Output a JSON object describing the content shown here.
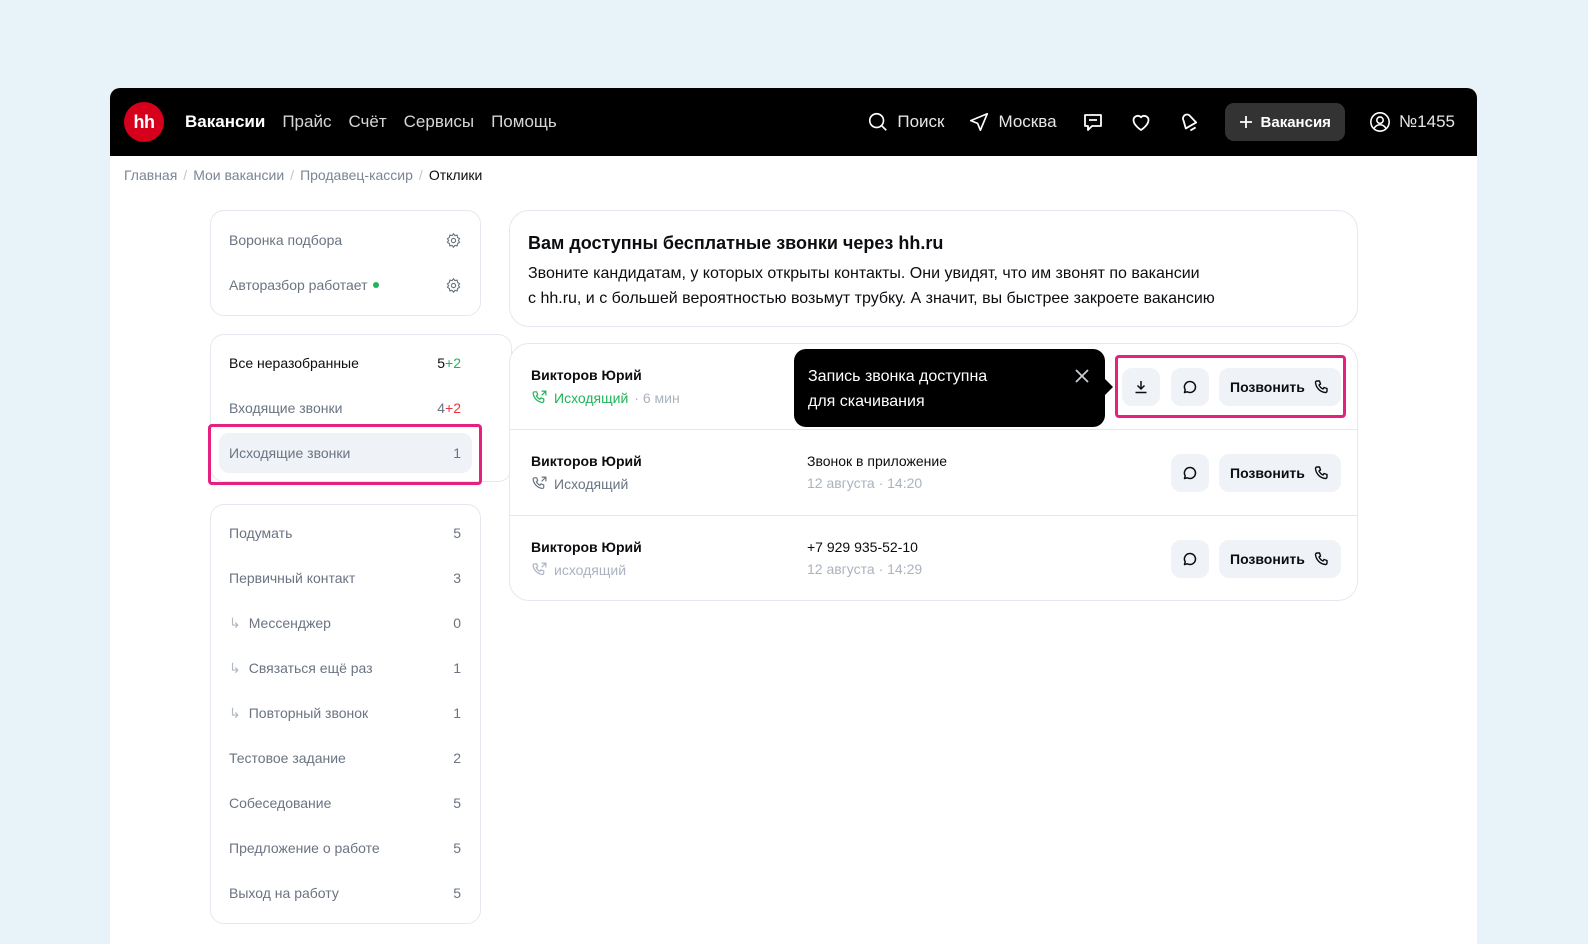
{
  "logo": "hh",
  "nav": {
    "items": [
      "Вакансии",
      "Прайс",
      "Счёт",
      "Сервисы",
      "Помощь"
    ],
    "search": "Поиск",
    "city": "Москва",
    "vacancy_button": "Вакансия",
    "account": "№1455"
  },
  "breadcrumb": [
    "Главная",
    "Мои вакансии",
    "Продавец-кассир",
    "Отклики"
  ],
  "settings": {
    "funnel": "Воронка подбора",
    "autosort": "Авторазбор работает"
  },
  "status_list": [
    {
      "label": "Все неразобранные",
      "count": "5",
      "extra": "+2"
    },
    {
      "label": "Входящие звонки",
      "count": "4",
      "extra": "+2"
    },
    {
      "label": "Исходящие звонки",
      "count": "1",
      "extra": ""
    }
  ],
  "stages": [
    {
      "label": "Подумать",
      "count": "5"
    },
    {
      "label": "Первичный контакт",
      "count": "3"
    },
    {
      "label": "Мессенджер",
      "count": "0"
    },
    {
      "label": "Связаться ещё раз",
      "count": "1"
    },
    {
      "label": "Повторный звонок",
      "count": "1"
    },
    {
      "label": "Тестовое задание",
      "count": "2"
    },
    {
      "label": "Собеседование",
      "count": "5"
    },
    {
      "label": "Предложение о работе",
      "count": "5"
    },
    {
      "label": "Выход на работу",
      "count": "5"
    }
  ],
  "info": {
    "title": "Вам доступны бесплатные звонки через hh.ru",
    "line1": "Звоните кандидатам, у которых открыты контакты. Они увидят, что им звонят по вакансии",
    "line2": "с hh.ru, и с большей вероятностью возьмут трубку. А значит, вы быстрее закроете вакансию"
  },
  "calls": [
    {
      "name": "Викторов Юрий",
      "type": "Исходящий",
      "time": "· 6 мин",
      "detail": "",
      "date": ""
    },
    {
      "name": "Викторов Юрий",
      "type": "Исходящий",
      "time": "",
      "detail": "Звонок в приложение",
      "date": "12 августа · 14:20"
    },
    {
      "name": "Викторов Юрий",
      "type": "исходящий",
      "time": "",
      "detail": "+7 929 935-52-10",
      "date": "12 августа · 14:29"
    }
  ],
  "call_button": "Позвонить",
  "tooltip": {
    "line1": "Запись звонка доступна",
    "line2": "для скачивания"
  },
  "colors": {
    "brand": "#d6001c",
    "highlight": "#e5207f",
    "green": "#1fb45a",
    "red": "#f0323c"
  }
}
